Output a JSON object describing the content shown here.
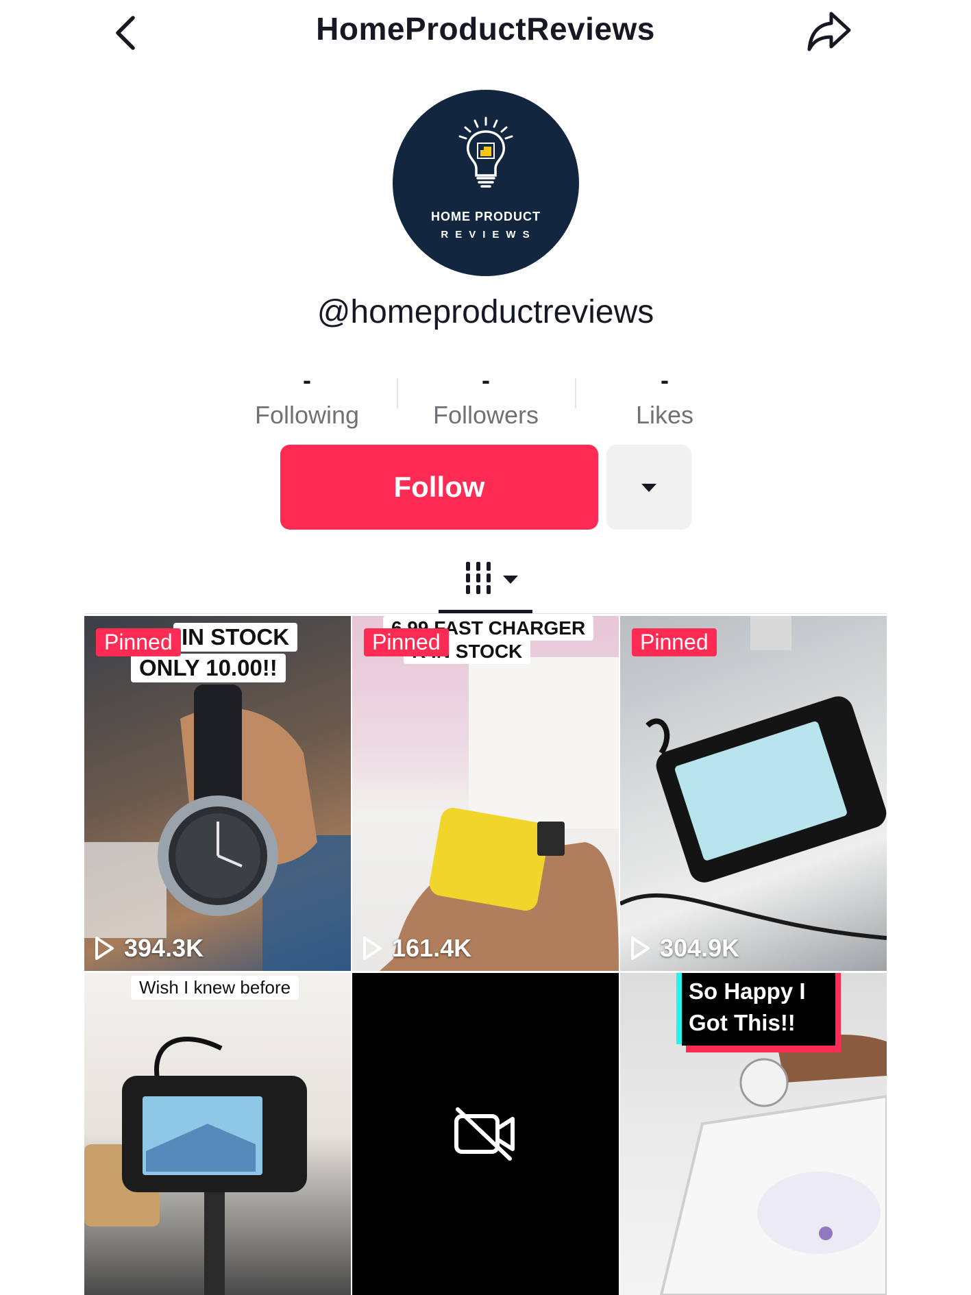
{
  "header": {
    "title": "HomeProductReviews",
    "back_icon": "chevron-left-icon",
    "share_icon": "share-arrow-icon"
  },
  "profile": {
    "avatar_line1": "HOME PRODUCT",
    "avatar_line2": "REVIEWS",
    "handle": "@homeproductreviews",
    "avatar_bg": "#12263f",
    "avatar_accent": "#f5c518"
  },
  "stats": [
    {
      "value": "-",
      "label": "Following"
    },
    {
      "value": "-",
      "label": "Followers"
    },
    {
      "value": "-",
      "label": "Likes"
    }
  ],
  "actions": {
    "follow_label": "Follow",
    "follow_color": "#fe2c55",
    "more_icon": "caret-down-icon"
  },
  "tabs": {
    "active_icon": "grid-icon",
    "dropdown_icon": "caret-down-icon"
  },
  "videos": [
    {
      "pinned": "Pinned",
      "caption1": "IN STOCK",
      "caption2": "ONLY 10.00!!",
      "views": "394.3K"
    },
    {
      "pinned": "Pinned",
      "caption1": "6.99 FAST CHARGER",
      "caption2": "K IN STOCK",
      "views": "161.4K"
    },
    {
      "pinned": "Pinned",
      "views": "304.9K"
    },
    {
      "caption1": "Wish I knew before"
    },
    {
      "unavailable_icon": "video-off-icon"
    },
    {
      "caption1": "So Happy I",
      "caption2": "Got This!!"
    }
  ]
}
